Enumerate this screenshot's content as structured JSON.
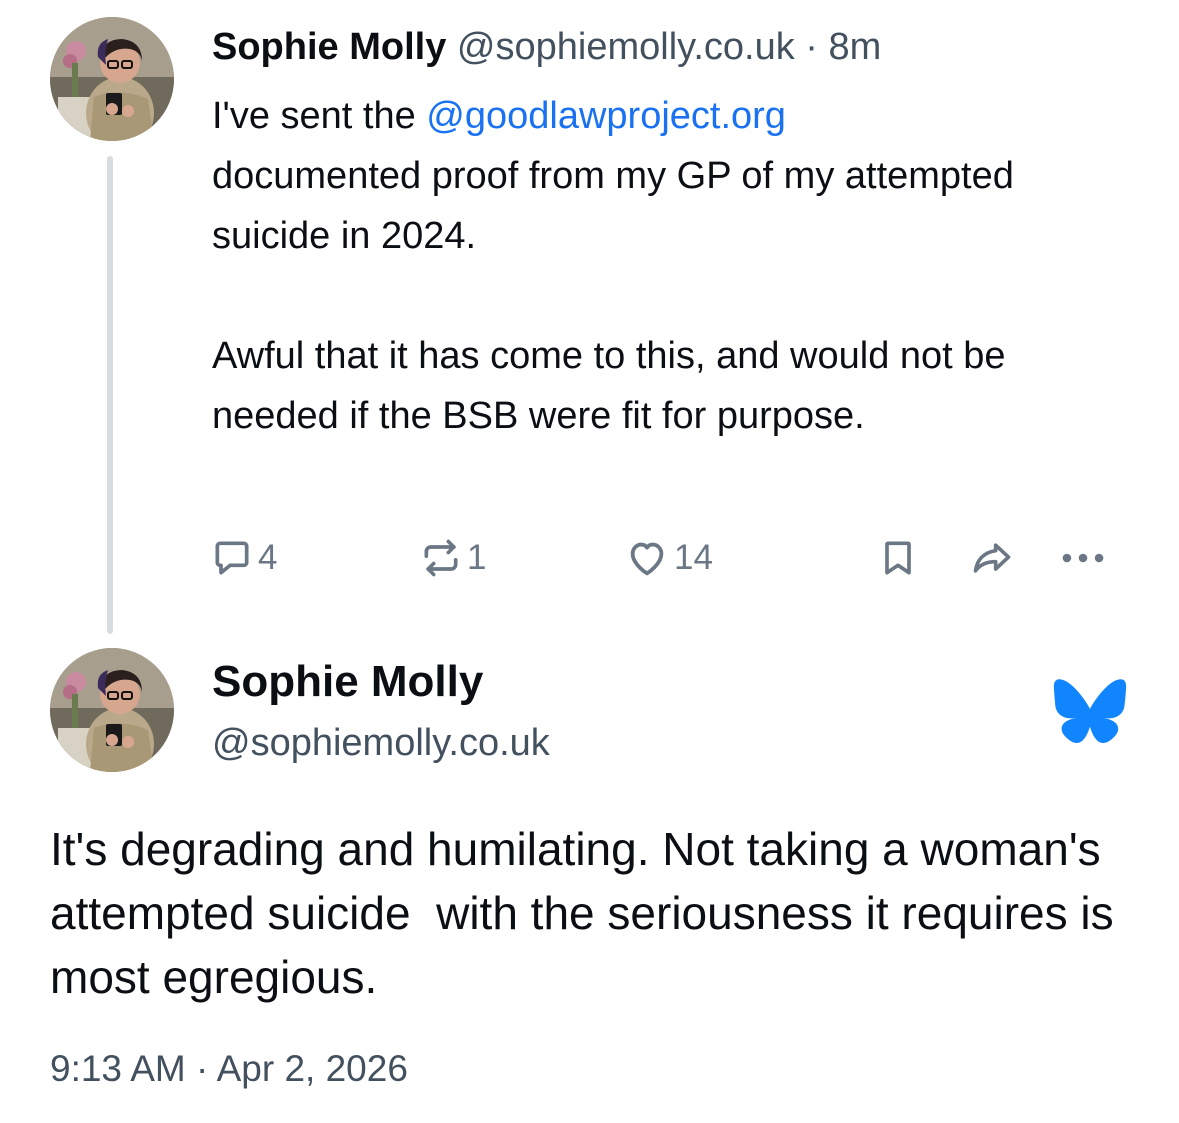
{
  "post1": {
    "author_name": "Sophie Molly",
    "author_handle": "@sophiemolly.co.uk",
    "separator": "·",
    "relative_time": "8m",
    "body_prefix": "I've sent the ",
    "mention": "@goodlawproject.org",
    "body_line1_rest": "documented proof from my GP of my attempted suicide in 2024.",
    "body_paragraph2": "Awful that it has come to this, and would not be needed if the BSB were fit for purpose.",
    "actions": {
      "reply_count": "4",
      "repost_count": "1",
      "like_count": "14",
      "reply_icon": "speech-bubble-icon",
      "repost_icon": "repost-arrows-icon",
      "like_icon": "heart-outline-icon",
      "bookmark_icon": "bookmark-icon",
      "share_icon": "share-arrow-icon",
      "more_icon": "ellipsis-icon"
    }
  },
  "post2": {
    "author_name": "Sophie Molly",
    "author_handle": "@sophiemolly.co.uk",
    "body": "It's degrading and humilating. Not taking a woman's attempted suicide  with the seriousness it requires is most egregious.",
    "timestamp": "9:13 AM · Apr 2, 2026",
    "platform_icon": "bluesky-butterfly-icon"
  },
  "colors": {
    "text_primary": "#0b0f14",
    "text_secondary": "#43505e",
    "mention_link": "#1a72f2",
    "action_icon": "#6b7785",
    "thread_line": "#d9dde1",
    "bluesky_brand": "#1185fe"
  }
}
